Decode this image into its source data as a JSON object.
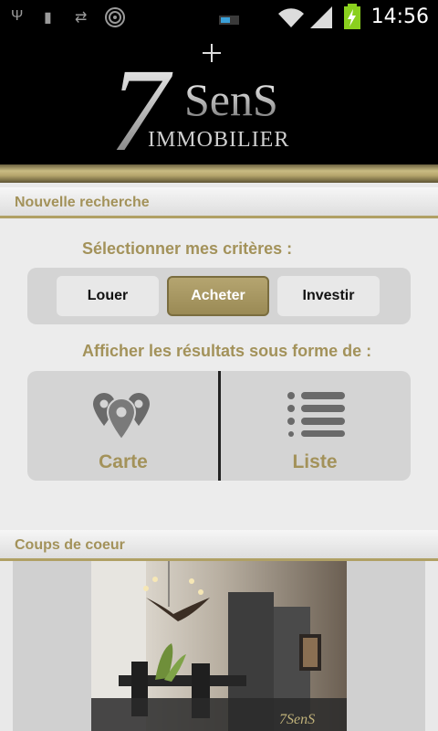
{
  "status_bar": {
    "time": "14:56",
    "icons": [
      "usb-icon",
      "sd-card-icon",
      "sync-icon",
      "hotspot-icon",
      "battery-small-icon",
      "wifi-icon",
      "signal-icon",
      "battery-charging-icon"
    ]
  },
  "header": {
    "logo_number": "7",
    "logo_word": "SenS",
    "logo_subtitle": "IMMOBILIER"
  },
  "search_section": {
    "title": "Nouvelle recherche",
    "criteria_label": "Sélectionner mes critères :",
    "options": [
      {
        "label": "Louer",
        "active": false
      },
      {
        "label": "Acheter",
        "active": true
      },
      {
        "label": "Investir",
        "active": false
      }
    ],
    "display_label": "Afficher les résultats sous forme de :",
    "views": [
      {
        "label": "Carte",
        "icon": "map-pins-icon"
      },
      {
        "label": "Liste",
        "icon": "list-icon"
      }
    ]
  },
  "favorites_section": {
    "title": "Coups de coeur",
    "photo_watermark": "7SenS"
  },
  "colors": {
    "gold": "#a3925a",
    "active_button": "#a89860"
  }
}
